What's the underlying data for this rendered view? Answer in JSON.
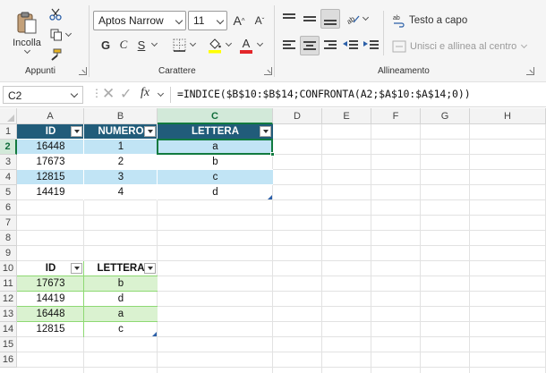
{
  "ribbon": {
    "clipboard": {
      "paste_label": "Incolla",
      "group_label": "Appunti"
    },
    "font": {
      "font_name": "Aptos Narrow",
      "font_size": "11",
      "bold": "G",
      "italic": "C",
      "underline": "S",
      "group_label": "Carattere"
    },
    "alignment": {
      "wrap_text_label": "Testo a capo",
      "merge_center_label": "Unisci e allinea al centro",
      "group_label": "Allineamento"
    }
  },
  "formula_bar": {
    "name_box": "C2",
    "fx": "fx",
    "formula": "=INDICE($B$10:$B$14;CONFRONTA(A2;$A$10:$A$14;0))"
  },
  "columns": [
    "A",
    "B",
    "C",
    "D",
    "E",
    "F",
    "G",
    "H"
  ],
  "rows": [
    "1",
    "2",
    "3",
    "4",
    "5",
    "6",
    "7",
    "8",
    "9",
    "10",
    "11",
    "12",
    "13",
    "14",
    "15",
    "16"
  ],
  "table1": {
    "headers": [
      "ID",
      "NUMERO",
      "LETTERA"
    ],
    "rows": [
      [
        "16448",
        "1",
        "a"
      ],
      [
        "17673",
        "2",
        "b"
      ],
      [
        "12815",
        "3",
        "c"
      ],
      [
        "14419",
        "4",
        "d"
      ]
    ]
  },
  "table2": {
    "headers": [
      "ID",
      "LETTERA"
    ],
    "rows": [
      [
        "17673",
        "b"
      ],
      [
        "14419",
        "d"
      ],
      [
        "16448",
        "a"
      ],
      [
        "12815",
        "c"
      ]
    ]
  },
  "colors": {
    "table1_header": "#215c7a",
    "table1_band": "#c1e4f5",
    "table2_header_border": "#8ed973",
    "table2_band": "#daf2d0",
    "selection": "#117a3f",
    "font_color_red": "#e3262a",
    "highlight_yellow": "#ffff00"
  }
}
